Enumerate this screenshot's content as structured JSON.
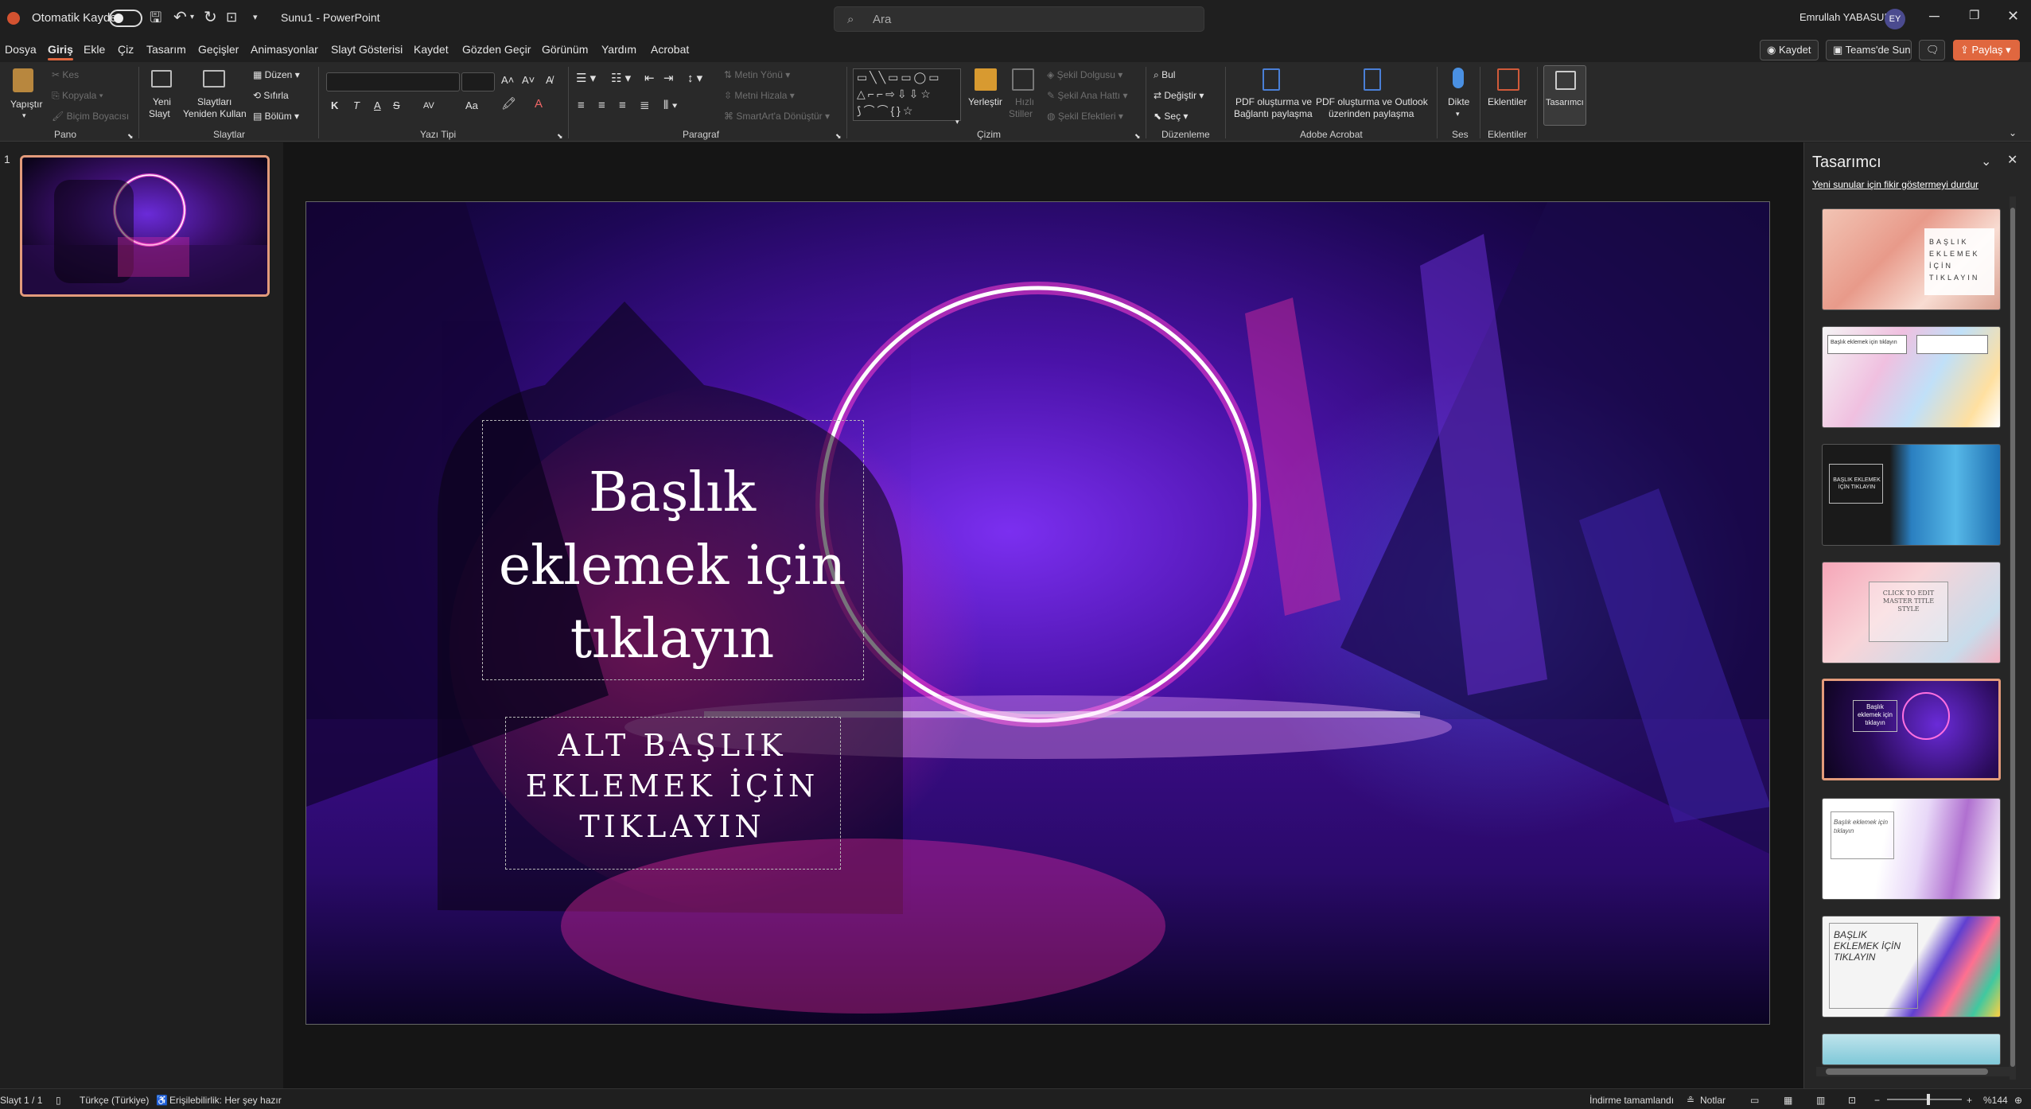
{
  "titlebar": {
    "autosave_label": "Otomatik Kaydet",
    "doc_title": "Sunu1  -  PowerPoint",
    "search_placeholder": "Ara",
    "user_name": "Emrullah YABASUN",
    "user_initials": "EY"
  },
  "menu": {
    "tabs": [
      "Dosya",
      "Giriş",
      "Ekle",
      "Çiz",
      "Tasarım",
      "Geçişler",
      "Animasyonlar",
      "Slayt Gösterisi",
      "Kaydet",
      "Gözden Geçir",
      "Görünüm",
      "Yardım",
      "Acrobat"
    ],
    "active": "Giriş",
    "record_label": "Kaydet",
    "teams_label": "Teams'de Sun",
    "share_label": "Paylaş"
  },
  "ribbon": {
    "pano": {
      "paste": "Yapıştır",
      "cut": "Kes",
      "copy": "Kopyala",
      "format_painter": "Biçim Boyacısı",
      "group": "Pano"
    },
    "slaytlar": {
      "new_slide_1": "Yeni",
      "new_slide_2": "Slayt",
      "reuse_1": "Slaytları",
      "reuse_2": "Yeniden Kullan",
      "layout": "Düzen",
      "reset": "Sıfırla",
      "section": "Bölüm",
      "group": "Slaytlar"
    },
    "font": {
      "group": "Yazı Tipi",
      "bold": "K",
      "italic": "T",
      "underline": "A",
      "strike": "S",
      "spacing": "AV",
      "case": "Aa"
    },
    "paragraph": {
      "text_direction": "Metin Yönü",
      "align_text": "Metni Hizala",
      "smartart": "SmartArt'a Dönüştür",
      "group": "Paragraf"
    },
    "drawing": {
      "arrange": "Yerleştir",
      "quick_styles_1": "Hızlı",
      "quick_styles_2": "Stiller",
      "shape_fill": "Şekil Dolgusu",
      "shape_outline": "Şekil Ana Hattı",
      "shape_effects": "Şekil Efektleri",
      "group": "Çizim"
    },
    "editing": {
      "find": "Bul",
      "replace": "Değiştir",
      "select": "Seç",
      "group": "Düzenleme"
    },
    "acrobat": {
      "pdf_link_1": "PDF oluşturma ve",
      "pdf_link_2": "Bağlantı paylaşma",
      "pdf_outlook_1": "PDF oluşturma ve Outlook",
      "pdf_outlook_2": "üzerinden paylaşma",
      "group": "Adobe Acrobat"
    },
    "voice": {
      "dictate": "Dikte",
      "group": "Ses"
    },
    "addins": {
      "addins": "Eklentiler",
      "group": "Eklentiler"
    },
    "designer": {
      "label": "Tasarımcı"
    }
  },
  "slides_panel": {
    "number": "1"
  },
  "slide": {
    "title": "Başlık eklemek için tıklayın",
    "subtitle": "ALT BAŞLIK EKLEMEK İÇİN TIKLAYIN"
  },
  "designer_pane": {
    "title": "Tasarımcı",
    "stop_link": "Yeni sunular için fikir göstermeyi durdur",
    "thumbs": [
      {
        "text": "BAŞLIK EKLEMEK İÇİN TIKLAYIN"
      },
      {
        "text": "Başlık eklemek için tıklayın"
      },
      {
        "text": "BAŞLIK EKLEMEK İÇİN TIKLAYIN"
      },
      {
        "text": "CLICK TO EDIT MASTER TITLE STYLE"
      },
      {
        "text": "Başlık eklemek için tıklayın"
      },
      {
        "text": "Başlık eklemek için tıklayın"
      },
      {
        "text": "BAŞLIK EKLEMEK İÇİN TIKLAYIN"
      }
    ]
  },
  "statusbar": {
    "slide_info": "Slayt 1 / 1",
    "language": "Türkçe (Türkiye)",
    "accessibility": "Erişilebilirlik: Her şey hazır",
    "download": "İndirme tamamlandı",
    "notes": "Notlar",
    "zoom": "%144"
  }
}
